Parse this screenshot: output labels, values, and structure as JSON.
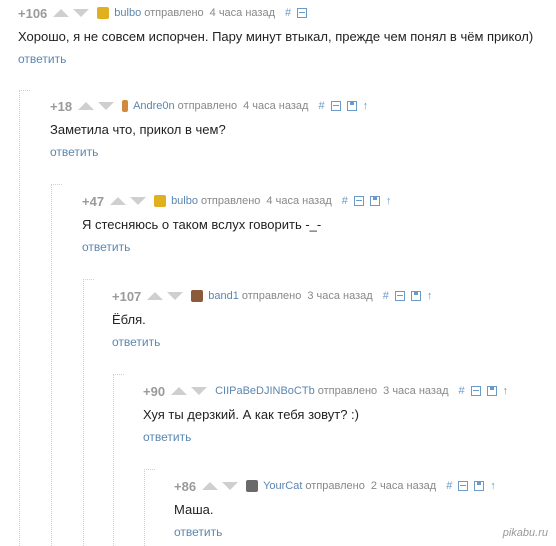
{
  "comments": [
    {
      "rating": "+106",
      "author": "bulbo",
      "avatar_color": "#e0b020",
      "sent": "отправлено",
      "time": "4 часа назад",
      "text": "Хорошо, я не совсем испорчен. Пару минут втыкал, прежде чем понял в чём прикол)",
      "reply": "ответить",
      "icons": [
        "hash-icon",
        "collapse-icon"
      ]
    },
    {
      "rating": "+18",
      "author": "Andre0n",
      "avatar_color": "#d08a40",
      "sent": "отправлено",
      "time": "4 часа назад",
      "text": "Заметила что, прикол в чем?",
      "reply": "ответить",
      "icons": [
        "hash-icon",
        "collapse-icon",
        "save-icon",
        "parent-arrow-icon"
      ]
    },
    {
      "rating": "+47",
      "author": "bulbo",
      "avatar_color": "#e0b020",
      "sent": "отправлено",
      "time": "4 часа назад",
      "text": "Я стесняюсь о таком вслух говорить -_-",
      "reply": "ответить",
      "icons": [
        "hash-icon",
        "collapse-icon",
        "save-icon",
        "parent-arrow-icon"
      ]
    },
    {
      "rating": "+107",
      "author": "band1",
      "avatar_color": "#8a5a3a",
      "sent": "отправлено",
      "time": "3 часа назад",
      "text": "Ёбля.",
      "reply": "ответить",
      "icons": [
        "hash-icon",
        "collapse-icon",
        "save-icon",
        "parent-arrow-icon"
      ]
    },
    {
      "rating": "+90",
      "author": "CIIPaBeDJINBoCTb",
      "avatar_color": "",
      "sent": "отправлено",
      "time": "3 часа назад",
      "text": "Хуя ты дерзкий. А как тебя зовут? :)",
      "reply": "ответить",
      "icons": [
        "hash-icon",
        "collapse-icon",
        "save-icon",
        "parent-arrow-icon"
      ]
    },
    {
      "rating": "+86",
      "author": "YourCat",
      "avatar_color": "#6a6a6a",
      "sent": "отправлено",
      "time": "2 часа назад",
      "text": "Маша.",
      "reply": "ответить",
      "icons": [
        "hash-icon",
        "collapse-icon",
        "save-icon",
        "parent-arrow-icon"
      ]
    }
  ],
  "watermark": "pikabu.ru"
}
